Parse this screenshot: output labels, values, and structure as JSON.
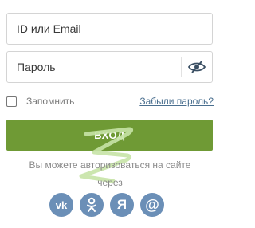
{
  "form": {
    "id_placeholder": "ID или Email",
    "password_placeholder": "Пароль",
    "remember_label": "Запомнить",
    "forgot_link": "Забыли пароль?",
    "login_button": "ВХОД"
  },
  "social": {
    "text_line1": "Вы можете авторизоваться на сайте",
    "text_line2": "через",
    "icons": [
      "vk-icon",
      "odnoklassniki-icon",
      "yandex-icon",
      "mail-at-icon"
    ],
    "vk_label": "vk",
    "yandex_label": "Я",
    "mail_label": "@"
  },
  "colors": {
    "accent_green": "#6f9a35",
    "social_blue": "#6b8fb7",
    "link": "#4a6f8f"
  }
}
